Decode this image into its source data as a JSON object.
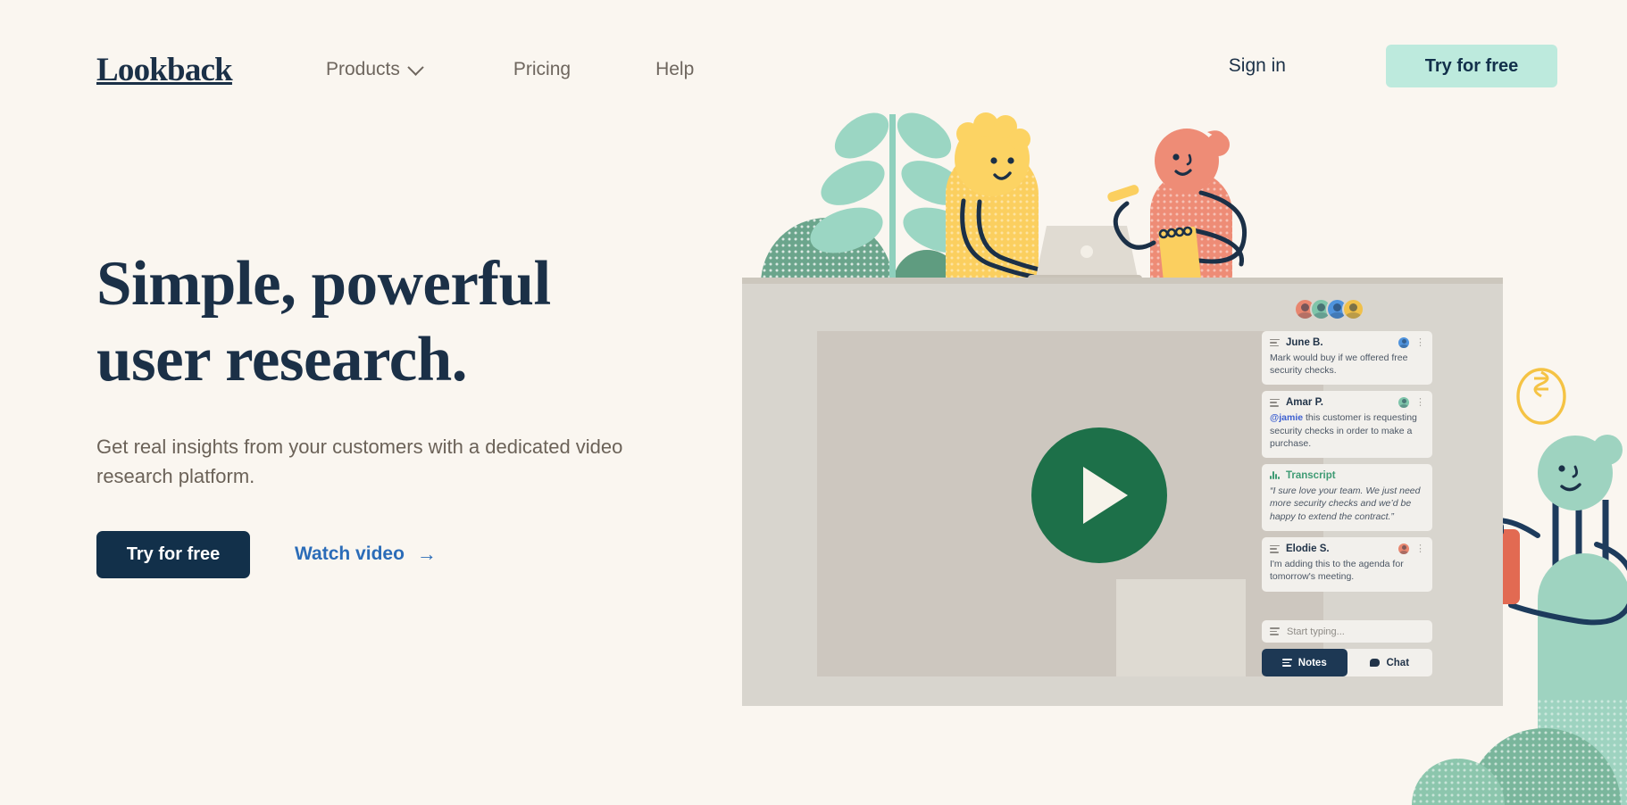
{
  "theme": {
    "background": "#faf6f0",
    "navy": "#1b3047",
    "mint": "#bdeadd",
    "link_blue": "#2b6cb8",
    "green": "#1d7049",
    "mockup_grey": "#d8d5ce"
  },
  "nav": {
    "logo": "Lookback",
    "links": [
      {
        "label": "Products",
        "icon": "chevron-down-icon",
        "has_dropdown": true
      },
      {
        "label": "Pricing",
        "has_dropdown": false
      },
      {
        "label": "Help",
        "has_dropdown": false
      }
    ],
    "signin_label": "Sign in",
    "cta_label": "Try for free"
  },
  "hero": {
    "headline_line1": "Simple, powerful",
    "headline_line2": "user research.",
    "subtext": "Get real insights from your customers with a dedicated video research platform.",
    "primary_cta": "Try for free",
    "secondary_cta": "Watch video",
    "secondary_arrow": "→"
  },
  "mockup": {
    "avatar_colors": [
      "#e8866f",
      "#7fc5aa",
      "#4f93dd",
      "#f0c04a"
    ],
    "play_button_label": "Play video",
    "notes": [
      {
        "type": "note",
        "author": "June B.",
        "avatar_color": "#4f93dd",
        "body": "Mark would buy if we offered free security checks.",
        "mention": null
      },
      {
        "type": "note",
        "author": "Amar P.",
        "avatar_color": "#7fc5aa",
        "mention": "@jamie",
        "body": " this customer is requesting security checks in order to make a purchase."
      },
      {
        "type": "transcript",
        "label": "Transcript",
        "body": "“I sure love your team. We just need more security checks and we’d be happy to extend the contract.”"
      },
      {
        "type": "note",
        "author": "Elodie S.",
        "avatar_color": "#e8866f",
        "body": "I'm adding this to the agenda for tomorrow's meeting.",
        "mention": null
      }
    ],
    "composer_placeholder": "Start typing...",
    "tabs": [
      {
        "label": "Notes",
        "icon": "list-icon",
        "active": true
      },
      {
        "label": "Chat",
        "icon": "chat-bubble-icon",
        "active": false
      }
    ]
  },
  "illustration": {
    "characters": [
      {
        "name": "person-yellow-laptop",
        "color": "#fbcf5f"
      },
      {
        "name": "person-salmon-notepad",
        "color": "#ee8c76"
      },
      {
        "name": "person-mint-clipboard",
        "color": "#9ed3c0"
      }
    ],
    "props": [
      "plant",
      "bush",
      "laptop",
      "notepad",
      "pencil",
      "clipboard",
      "speech-bubble"
    ]
  }
}
